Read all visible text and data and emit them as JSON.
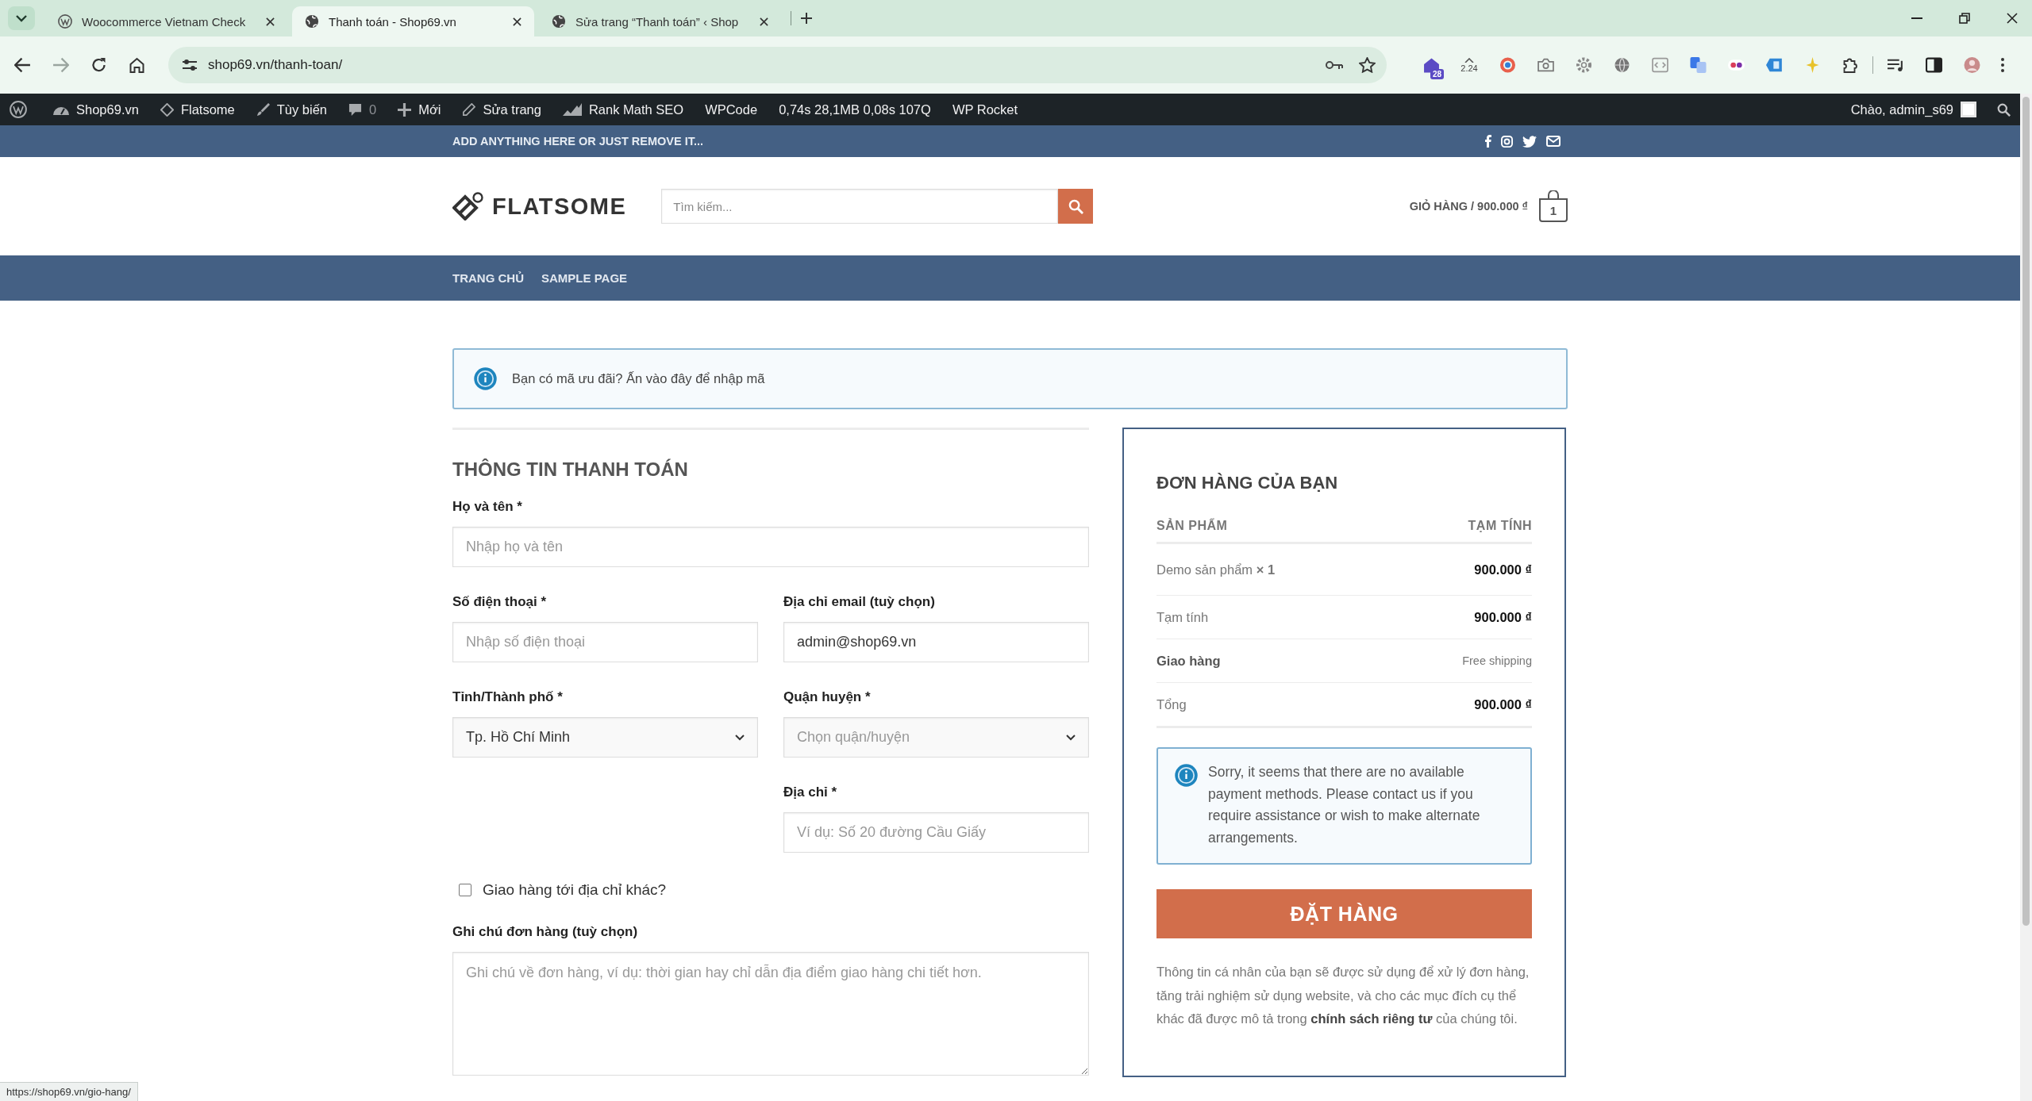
{
  "browser": {
    "tabs": [
      {
        "kind": "wordpress",
        "title": "Woocommerce Vietnam Check",
        "selected": false
      },
      {
        "kind": "site",
        "title": "Thanh toán - Shop69.vn",
        "selected": true
      },
      {
        "kind": "site",
        "title": "Sửa trang “Thanh toán” ‹ Shop",
        "selected": false
      }
    ],
    "url": "shop69.vn/thanh-toan/",
    "extension_badge": "28",
    "extension_reading": "2.24"
  },
  "admin_bar": {
    "items": [
      {
        "kind": "wordpress"
      },
      {
        "kind": "site",
        "label": "Shop69.vn"
      },
      {
        "kind": "theme",
        "label": "Flatsome"
      },
      {
        "kind": "customize",
        "label": "Tùy biến"
      },
      {
        "kind": "comments",
        "label": "0"
      },
      {
        "kind": "new",
        "label": "Mới"
      },
      {
        "kind": "edit",
        "label": "Sửa trang"
      },
      {
        "kind": "seo",
        "label": "Rank Math SEO"
      },
      {
        "kind": "plain",
        "label": "WPCode"
      },
      {
        "kind": "plain",
        "label": "0,74s 28,1MB 0,08s 107Q"
      },
      {
        "kind": "plain",
        "label": "WP Rocket"
      }
    ],
    "account": "Chào, admin_s69"
  },
  "top_bar": {
    "text": "ADD ANYTHING HERE OR JUST REMOVE IT..."
  },
  "header": {
    "logo": "FLATSOME",
    "search": {
      "placeholder": "Tìm kiếm..."
    },
    "cart": {
      "label": "GIỎ HÀNG / 900.000 ₫",
      "count": "1"
    }
  },
  "nav": [
    "TRANG CHỦ",
    "SAMPLE PAGE"
  ],
  "coupon_notice": "Bạn có mã ưu đãi? Ấn vào đây để nhập mã",
  "billing": {
    "title": "THÔNG TIN THANH TOÁN",
    "rows": [
      [
        {
          "kind": "text",
          "label": "Họ và tên *",
          "placeholder": "Nhập họ và tên"
        }
      ],
      [
        {
          "kind": "text",
          "label": "Số điện thoại *",
          "placeholder": "Nhập số điện thoại"
        },
        {
          "kind": "text",
          "label": "Địa chỉ email (tuỳ chọn)",
          "value": "admin@shop69.vn"
        }
      ],
      [
        {
          "kind": "select",
          "label": "Tỉnh/Thành phố *",
          "value": "Tp. Hồ Chí Minh"
        },
        {
          "kind": "select",
          "label": "Quận huyện *",
          "placeholder": "Chọn quận/huyện"
        }
      ],
      [
        null,
        {
          "kind": "text",
          "label": "Địa chỉ *",
          "placeholder": "Ví dụ: Số 20 đường Cầu Giấy"
        }
      ]
    ],
    "ship_elsewhere": {
      "label": "Giao hàng tới địa chỉ khác?",
      "checked": false
    },
    "notes": {
      "label": "Ghi chú đơn hàng (tuỳ chọn)",
      "placeholder": "Ghi chú về đơn hàng, ví dụ: thời gian hay chỉ dẫn địa điểm giao hàng chi tiết hơn."
    }
  },
  "order": {
    "title": "ĐƠN HÀNG CỦA BẠN",
    "columns": [
      "SẢN PHẨM",
      "TẠM TÍNH"
    ],
    "rows": [
      {
        "kind": "item",
        "label": "Demo sản phẩm **× 1**",
        "value": "900.000 ₫"
      },
      {
        "kind": "subtotal",
        "label": "Tạm tính",
        "value": "900.000 ₫"
      },
      {
        "kind": "shipping",
        "label": "Giao hàng",
        "value": "Free shipping"
      },
      {
        "kind": "total",
        "label": "Tổng",
        "value": "900.000 ₫"
      }
    ],
    "payment_notice": "Sorry, it seems that there are no available payment methods. Please contact us if you require assistance or wish to make alternate arrangements.",
    "button": "ĐẶT HÀNG",
    "privacy": {
      "before": "Thông tin cá nhân của bạn sẽ được sử dụng để xử lý đơn hàng, tăng trải nghiệm sử dụng website, và cho các mục đích cụ thể khác đã được mô tả trong",
      "link": "chính sách riêng tư",
      "after": "của chúng tôi."
    }
  },
  "status_link": "https://shop69.vn/gio-hang/"
}
